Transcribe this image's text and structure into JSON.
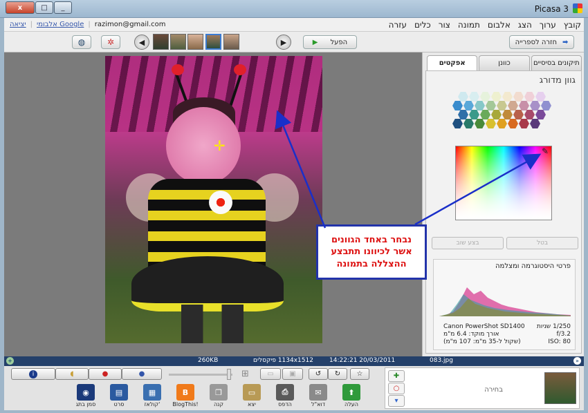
{
  "window": {
    "title": "Picasa 3",
    "close": "x",
    "restore": "□",
    "minimize": "_"
  },
  "menu": {
    "items": [
      "קובץ",
      "ערוך",
      "הצג",
      "אלבום",
      "תמונה",
      "צור",
      "כלים",
      "עזרה"
    ]
  },
  "account": {
    "email": "razimon@gmail.com",
    "albums_link": "אלבומי Google",
    "signout": "יציאה"
  },
  "toolbar": {
    "back_label": "חזרה לספרייה",
    "play_label": "הפעל"
  },
  "panel": {
    "tabs": [
      "תיקונים בסיסיים",
      "כוונן",
      "אפקטים"
    ],
    "effect_title": "גוון מדורג",
    "cancel_label": "בטל",
    "apply_label": "בצע שוב"
  },
  "histogram": {
    "title": "פרטי היסטוגרמה ומצלמה",
    "camera": "Canon PowerShot SD1400",
    "focal": "אורך מוקד: 6.4 מ\"מ",
    "equiv": "(שקול ל-35 מ\"מ: 107 מ\"מ)",
    "shutter": "1/250 שניות",
    "aperture": "f/3.2",
    "iso": "ISO: 80"
  },
  "callout": {
    "text": "נבחר באחד הגוונים אשר לכיוונו תתבצע ההצללה בתמונה"
  },
  "status": {
    "size": "260KB",
    "dims": "1134x1512 פיקסלים",
    "datetime": "14:22:21 20/03/2011",
    "filename": "083.jpg"
  },
  "tray": {
    "actions": [
      {
        "label": "העלה",
        "icon": "upload-icon",
        "color": "#2f9a3b",
        "glyph": "⬆"
      },
      {
        "label": "דוא\"ל",
        "icon": "email-icon",
        "color": "#8a8a8a",
        "glyph": "✉"
      },
      {
        "label": "הדפס",
        "icon": "print-icon",
        "color": "#5a5a5a",
        "glyph": "⎙"
      },
      {
        "label": "יצא",
        "icon": "export-icon",
        "color": "#b89a55",
        "glyph": "▭"
      },
      {
        "label": "קנה",
        "icon": "shop-icon",
        "color": "#999999",
        "glyph": "❐"
      },
      {
        "label": "BlogThis!",
        "icon": "blogger-icon",
        "color": "#f07a1a",
        "glyph": "B"
      },
      {
        "label": "קולאז'",
        "icon": "collage-icon",
        "color": "#3a6fb0",
        "glyph": "▦"
      },
      {
        "label": "סרט",
        "icon": "movie-icon",
        "color": "#2b5aa0",
        "glyph": "▤"
      },
      {
        "label": "סמן בתג",
        "icon": "geotag-icon",
        "color": "#1b3a7a",
        "glyph": "◉"
      }
    ],
    "selection_label": "בחירה"
  }
}
